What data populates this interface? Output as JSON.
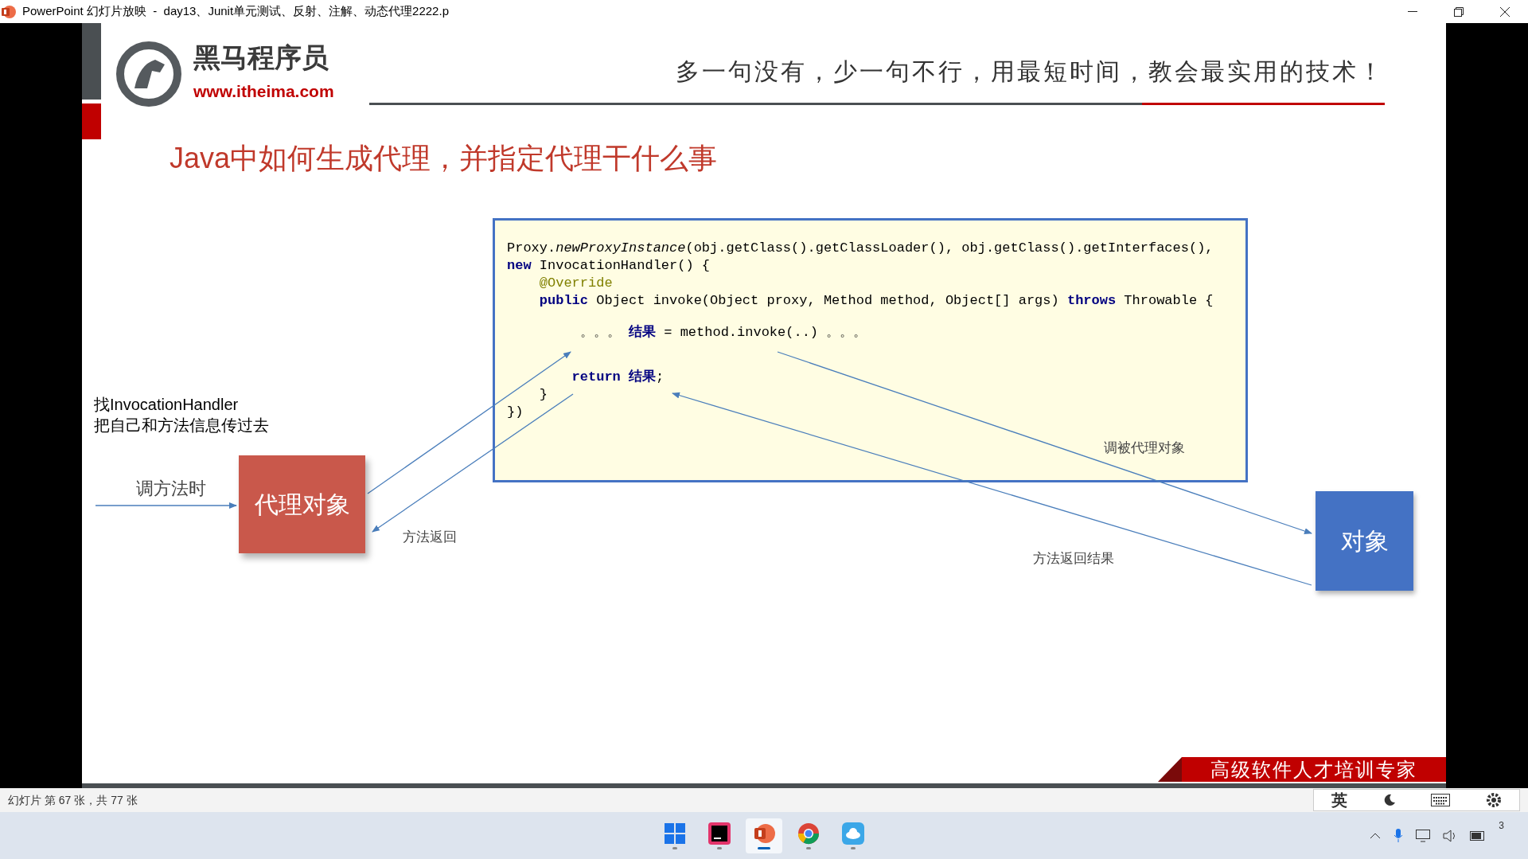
{
  "window": {
    "title": "PowerPoint 幻灯片放映  -  day13、Junit单元测试、反射、注解、动态代理2222.p"
  },
  "slide": {
    "logo": {
      "name": "黑马程序员",
      "url": "www.itheima.com"
    },
    "slogan": "多一句没有，少一句不行，用最短时间，教会最实用的技术！",
    "heading": "Java中如何生成代理，并指定代理干什么事",
    "code": {
      "blocks": [
        [
          {
            "tokens": [
              {
                "kind": "plain",
                "text": "Proxy."
              },
              {
                "kind": "method",
                "text": "newProxyInstance"
              },
              {
                "kind": "plain",
                "text": "(obj.getClass().getClassLoader(), obj.getClass().getInterfaces(),"
              }
            ]
          },
          {
            "tokens": [
              {
                "kind": "keyword",
                "text": "new"
              },
              {
                "kind": "plain",
                "text": " InvocationHandler() {"
              }
            ]
          },
          {
            "tokens": [
              {
                "kind": "annotation",
                "text": "    @Override"
              }
            ]
          },
          {
            "tokens": [
              {
                "kind": "keyword",
                "text": "    public"
              },
              {
                "kind": "plain",
                "text": " Object invoke(Object proxy, Method method, Object[] args) "
              },
              {
                "kind": "keyword",
                "text": "throws"
              },
              {
                "kind": "plain",
                "text": " Throwable {"
              }
            ]
          }
        ],
        [
          {
            "tokens": [
              {
                "kind": "plain",
                "text": "         。。。 "
              },
              {
                "kind": "keyword",
                "text": "结果"
              },
              {
                "kind": "plain",
                "text": " = method.invoke(..) 。。。"
              }
            ]
          }
        ],
        [
          {
            "tokens": [
              {
                "kind": "keyword",
                "text": "        return"
              },
              {
                "kind": "keyword",
                "text": " 结果"
              },
              {
                "kind": "plain",
                "text": ";"
              }
            ]
          },
          {
            "tokens": [
              {
                "kind": "plain",
                "text": "    }"
              }
            ]
          },
          {
            "tokens": [
              {
                "kind": "plain",
                "text": "})"
              }
            ]
          }
        ]
      ]
    },
    "note_lines": [
      "找InvocationHandler",
      "把自己和方法信息传过去"
    ],
    "labels": {
      "call_method": "调方法时",
      "method_return": "方法返回",
      "call_target": "调被代理对象",
      "return_result": "方法返回结果"
    },
    "nodes": [
      {
        "kind": "proxy",
        "text": "代理对象",
        "color": "#c9584b"
      },
      {
        "kind": "target",
        "text": "对象",
        "color": "#4472c4"
      }
    ],
    "banner": "高级软件人才培训专家"
  },
  "status_bar": {
    "text": "幻灯片 第 67 张，共 77 张"
  },
  "ime_toolbar": {
    "language": "英"
  },
  "taskbar": {
    "apps": [
      {
        "kind": "windows",
        "selected": false
      },
      {
        "kind": "idea",
        "selected": false
      },
      {
        "kind": "powerpoint",
        "selected": true
      },
      {
        "kind": "chrome",
        "selected": false
      },
      {
        "kind": "cloud",
        "selected": false
      }
    ],
    "tray_badge": "3"
  }
}
